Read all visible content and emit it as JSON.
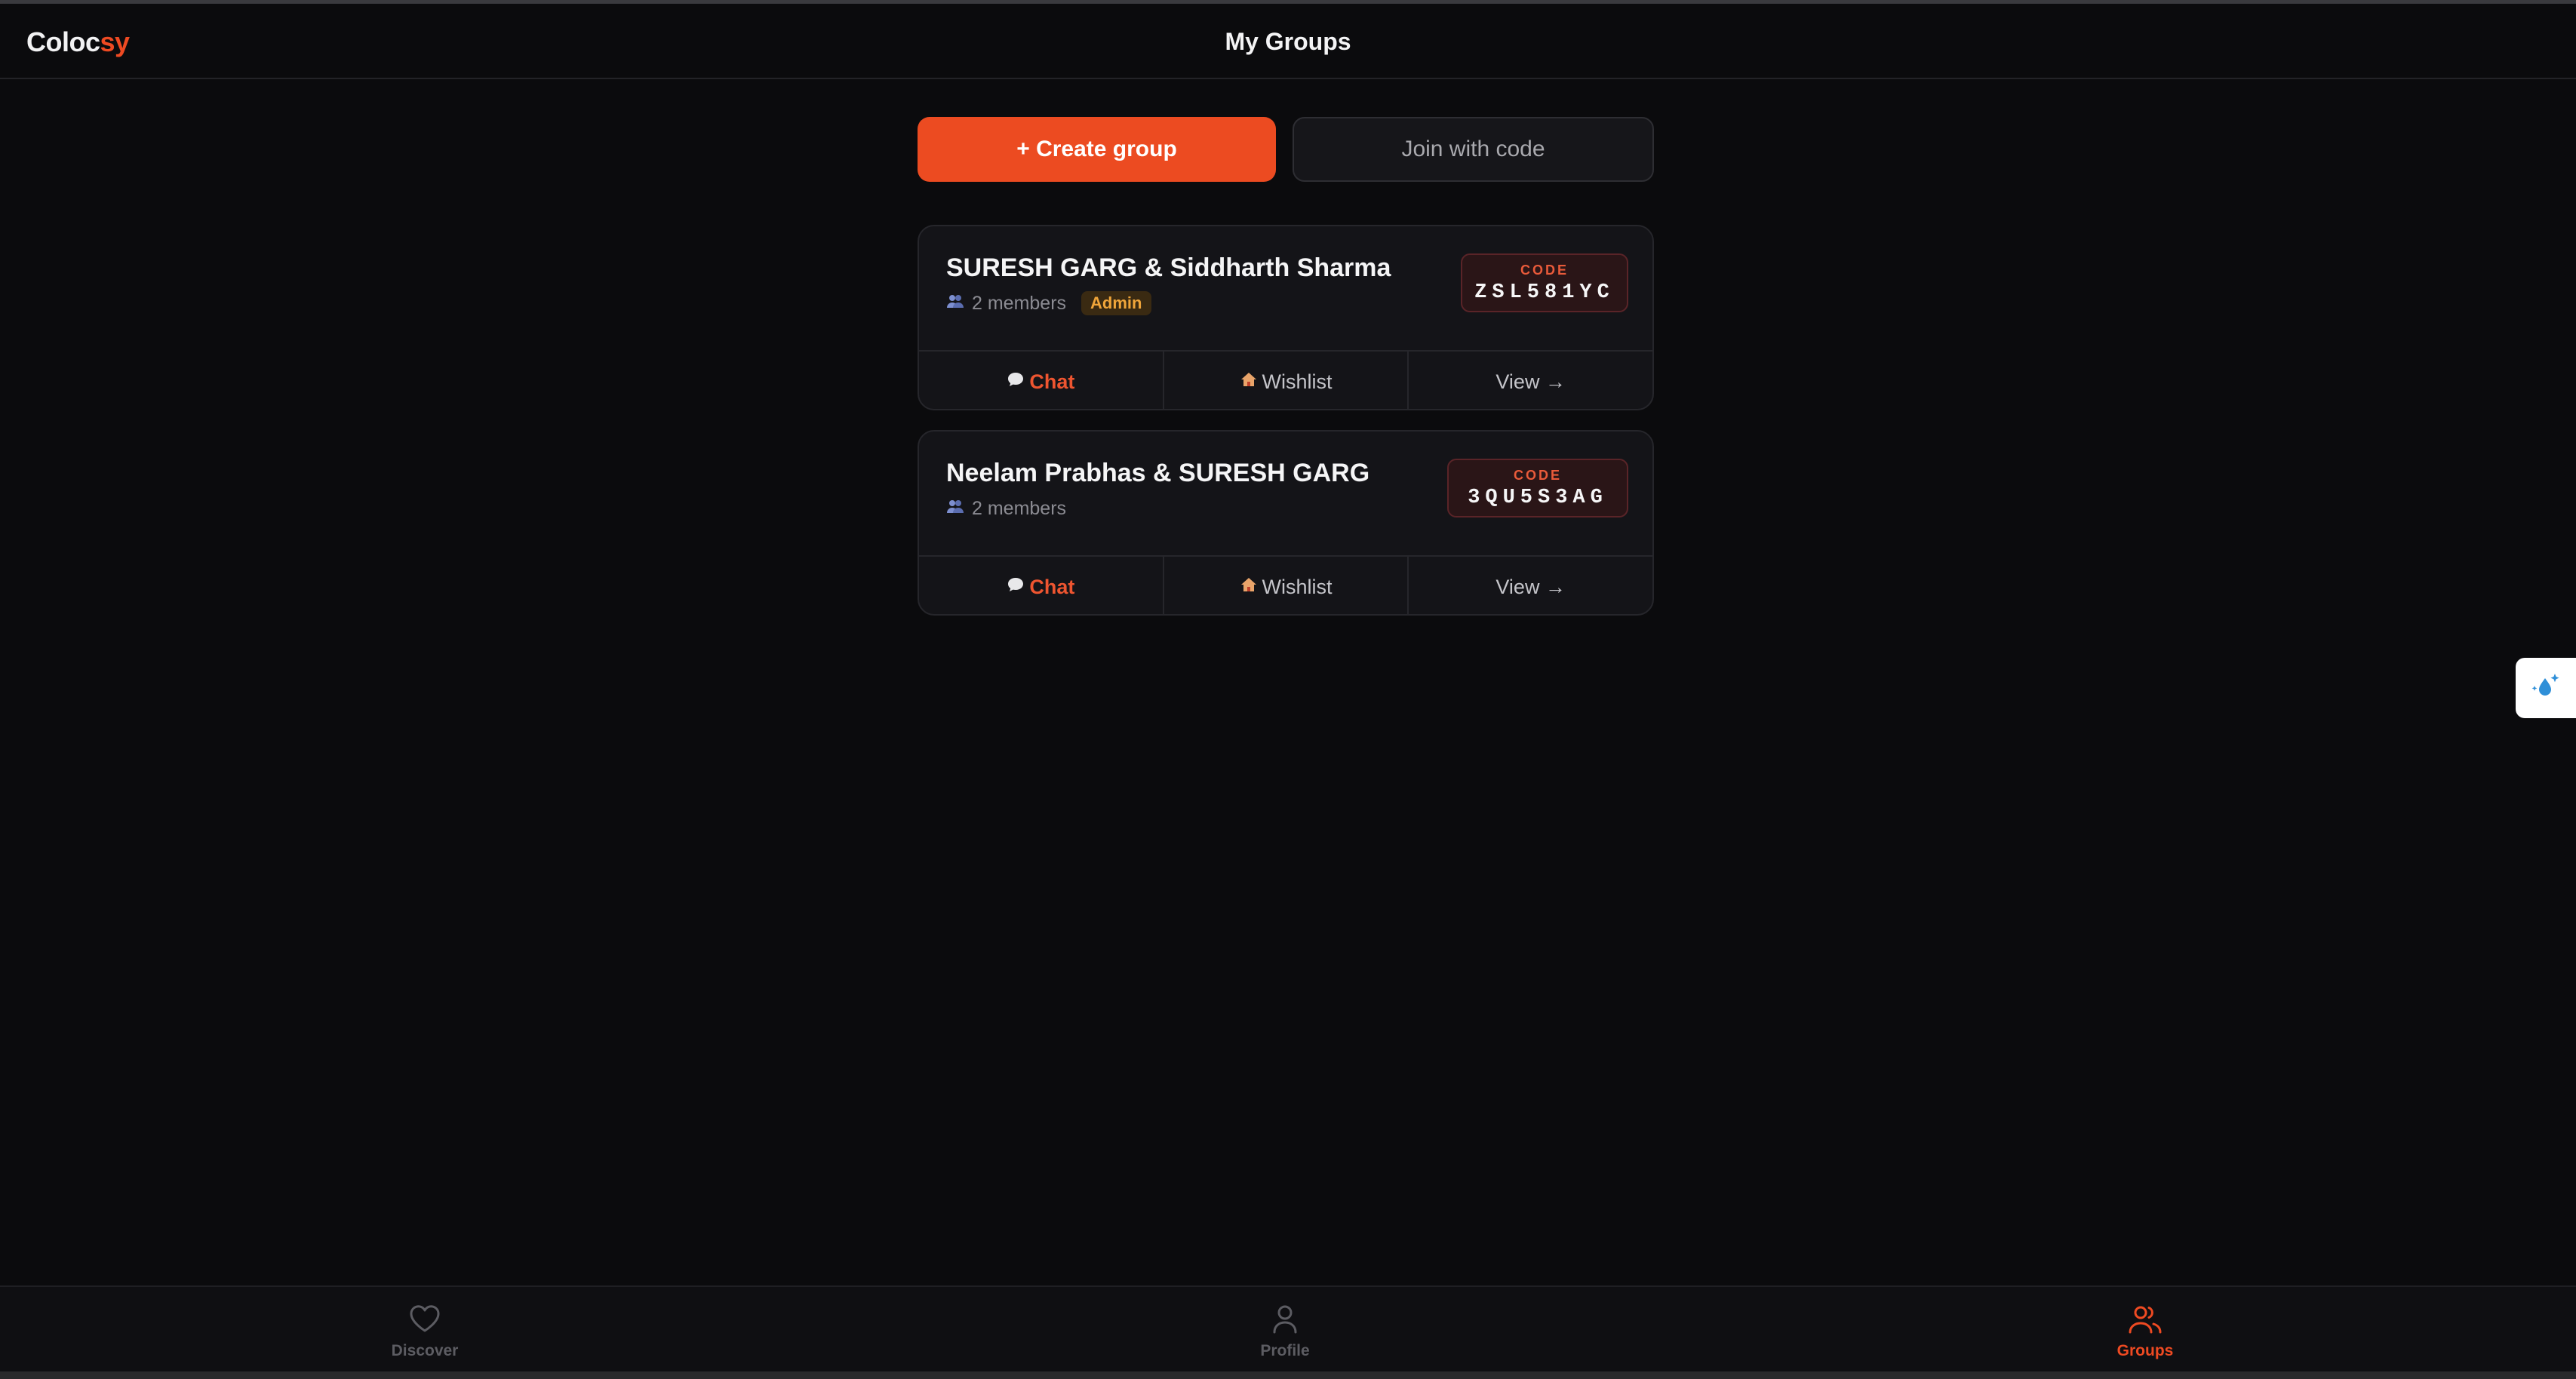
{
  "app": {
    "logo_primary": "Coloc",
    "logo_accent": "sy",
    "title": "My Groups"
  },
  "actions": {
    "create_label": "+ Create group",
    "join_label": "Join with code"
  },
  "groups": [
    {
      "name": "SURESH GARG & Siddharth Sharma",
      "members": "2 members",
      "badge": "Admin",
      "code_label": "CODE",
      "code": "ZSL581YC",
      "chat_label": "Chat",
      "wishlist_label": "Wishlist",
      "view_label": "View →"
    },
    {
      "name": "Neelam Prabhas & SURESH GARG",
      "members": "2 members",
      "code_label": "CODE",
      "code": "3QU5S3AG",
      "chat_label": "Chat",
      "wishlist_label": "Wishlist",
      "view_label": "View →"
    }
  ],
  "nav": {
    "discover": "Discover",
    "profile": "Profile",
    "groups": "Groups",
    "active": "groups"
  },
  "colors": {
    "accent": "#ec4b21",
    "background": "#0b0b0d",
    "card": "#141418",
    "admin_badge": "#f0a53a"
  },
  "icons": {
    "members": "people-icon",
    "chat": "speech-bubble-icon",
    "wishlist": "house-icon",
    "discover": "heart-icon",
    "profile": "person-icon",
    "groups": "group-icon",
    "side_widget": "sparkle-drop-icon"
  }
}
